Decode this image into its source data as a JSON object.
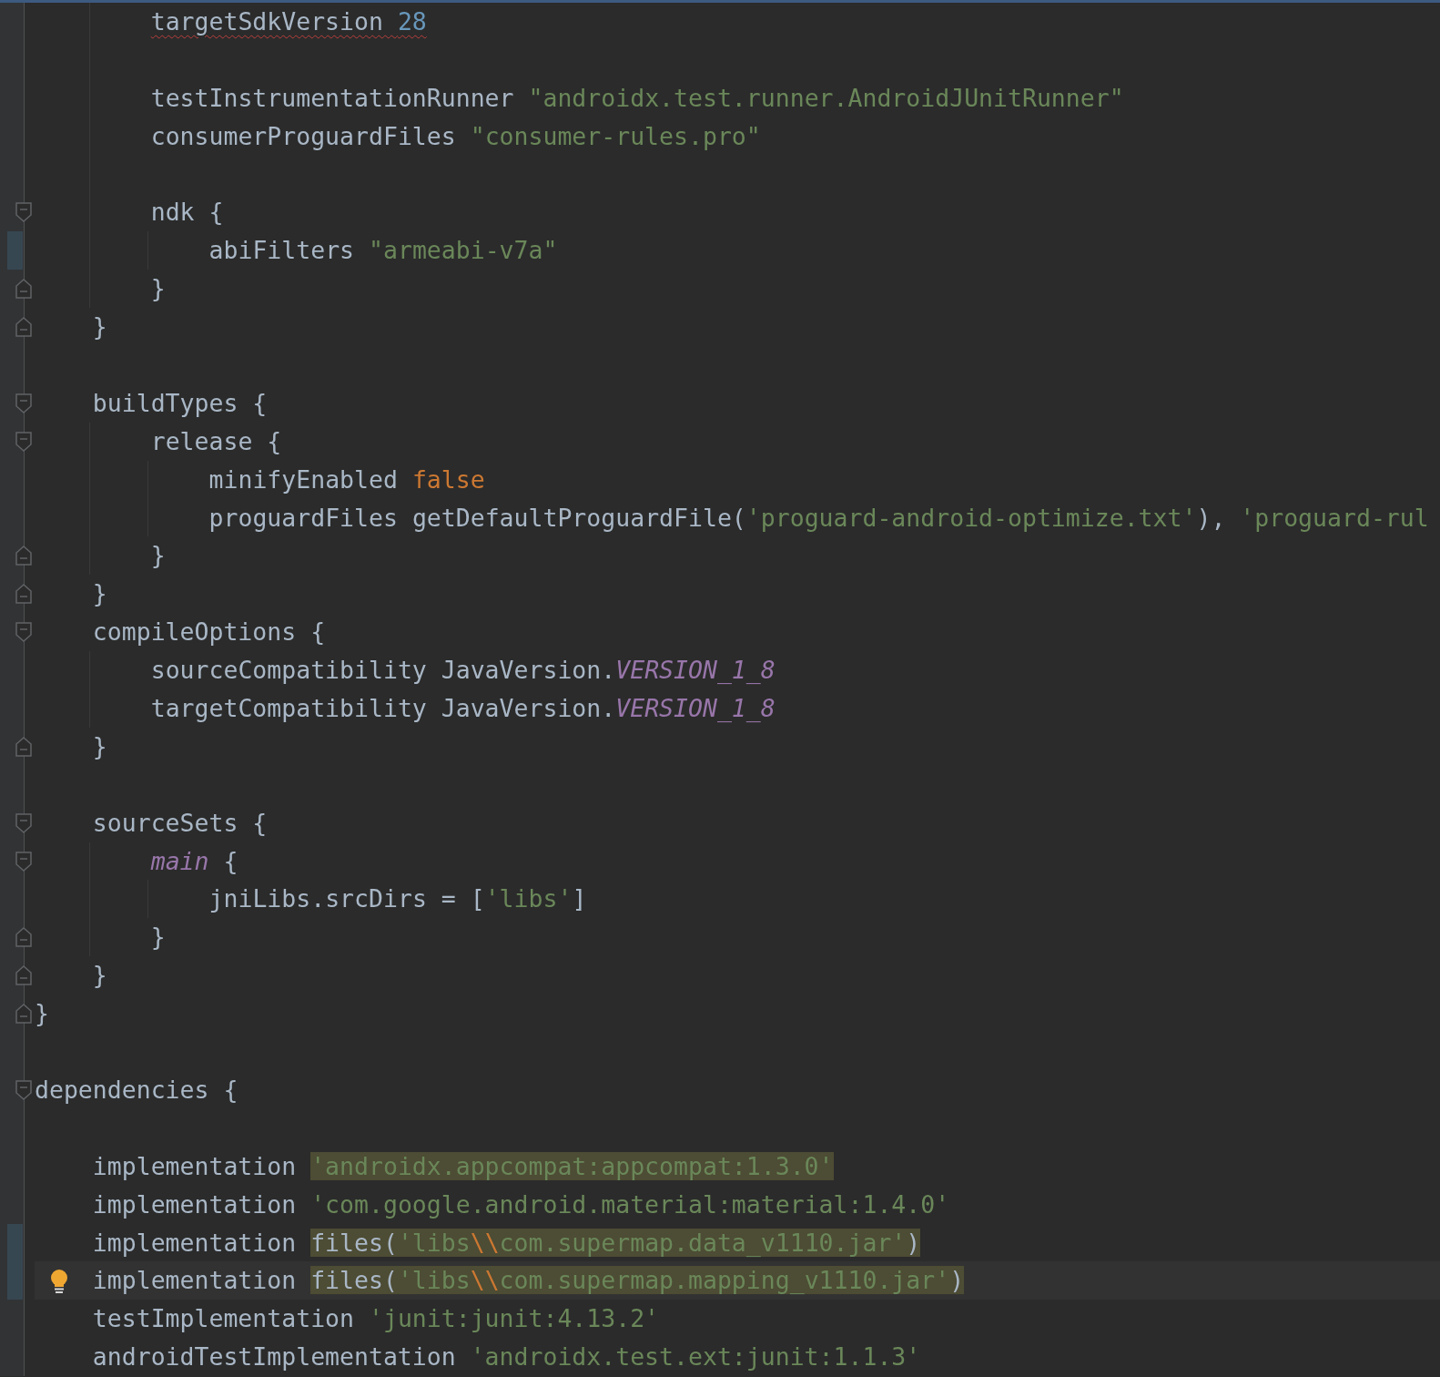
{
  "editor": {
    "lines": [
      {
        "kind": "block",
        "expanded": true,
        "close": "}",
        "children": [
          {
            "kind": "block",
            "expanded": true,
            "close": "}",
            "children": [
              {
                "kind": "line",
                "tokens": [
                  {
                    "text": "targetSdkVersion ",
                    "kind": "plain",
                    "error": true
                  },
                  {
                    "text": "28",
                    "kind": "number",
                    "error": true
                  }
                ]
              },
              {
                "kind": "blank"
              },
              {
                "kind": "line",
                "tokens": [
                  {
                    "text": "testInstrumentationRunner ",
                    "kind": "plain"
                  },
                  {
                    "text": "\"androidx.test.runner.AndroidJUnitRunner\"",
                    "kind": "string"
                  }
                ]
              },
              {
                "kind": "line",
                "tokens": [
                  {
                    "text": "consumerProguardFiles ",
                    "kind": "plain"
                  },
                  {
                    "text": "\"consumer-rules.pro\"",
                    "kind": "string"
                  }
                ]
              },
              {
                "kind": "blank"
              },
              {
                "kind": "block",
                "expanded": true,
                "tokens": [
                  {
                    "text": "ndk {",
                    "kind": "plain"
                  }
                ],
                "close": "}",
                "children": [
                  {
                    "kind": "line",
                    "changed": true,
                    "tokens": [
                      {
                        "text": "abiFilters ",
                        "kind": "plain"
                      },
                      {
                        "text": "\"armeabi-v7a\"",
                        "kind": "string"
                      }
                    ]
                  }
                ]
              }
            ]
          },
          {
            "kind": "blank"
          },
          {
            "kind": "block",
            "expanded": true,
            "tokens": [
              {
                "text": "buildTypes {",
                "kind": "plain"
              }
            ],
            "close": "}",
            "children": [
              {
                "kind": "block",
                "expanded": true,
                "tokens": [
                  {
                    "text": "release {",
                    "kind": "plain"
                  }
                ],
                "close": "}",
                "children": [
                  {
                    "kind": "line",
                    "tokens": [
                      {
                        "text": "minifyEnabled ",
                        "kind": "plain"
                      },
                      {
                        "text": "false",
                        "kind": "keyword"
                      }
                    ]
                  },
                  {
                    "kind": "line",
                    "tokens": [
                      {
                        "text": "proguardFiles getDefaultProguardFile(",
                        "kind": "plain"
                      },
                      {
                        "text": "'proguard-android-optimize.txt'",
                        "kind": "string"
                      },
                      {
                        "text": "), ",
                        "kind": "plain"
                      },
                      {
                        "text": "'proguard-rul",
                        "kind": "string"
                      }
                    ]
                  }
                ]
              }
            ]
          },
          {
            "kind": "block",
            "expanded": true,
            "tokens": [
              {
                "text": "compileOptions {",
                "kind": "plain"
              }
            ],
            "close": "}",
            "children": [
              {
                "kind": "line",
                "tokens": [
                  {
                    "text": "sourceCompatibility JavaVersion.",
                    "kind": "plain"
                  },
                  {
                    "text": "VERSION_1_8",
                    "kind": "constant"
                  }
                ]
              },
              {
                "kind": "line",
                "tokens": [
                  {
                    "text": "targetCompatibility JavaVersion.",
                    "kind": "plain"
                  },
                  {
                    "text": "VERSION_1_8",
                    "kind": "constant"
                  }
                ]
              }
            ]
          },
          {
            "kind": "blank"
          },
          {
            "kind": "block",
            "expanded": true,
            "tokens": [
              {
                "text": "sourceSets {",
                "kind": "plain"
              }
            ],
            "close": "}",
            "children": [
              {
                "kind": "block",
                "expanded": true,
                "tokens": [
                  {
                    "text": "main",
                    "kind": "constant"
                  },
                  {
                    "text": " {",
                    "kind": "plain"
                  }
                ],
                "close": "}",
                "children": [
                  {
                    "kind": "line",
                    "tokens": [
                      {
                        "text": "jniLibs.srcDirs = [",
                        "kind": "plain"
                      },
                      {
                        "text": "'libs'",
                        "kind": "string"
                      },
                      {
                        "text": "]",
                        "kind": "plain"
                      }
                    ]
                  }
                ]
              }
            ]
          }
        ]
      },
      {
        "kind": "blank"
      },
      {
        "kind": "block",
        "expanded": true,
        "tokens": [
          {
            "text": "dependencies {",
            "kind": "plain"
          }
        ],
        "children": [
          {
            "kind": "blank"
          },
          {
            "kind": "line",
            "tokens": [
              {
                "text": "implementation ",
                "kind": "plain"
              },
              {
                "text": "'androidx.appcompat:appcompat:1.3.0'",
                "kind": "string",
                "highlight": true
              }
            ]
          },
          {
            "kind": "line",
            "tokens": [
              {
                "text": "implementation ",
                "kind": "plain"
              },
              {
                "text": "'com.google.android.material:material:1.4.0'",
                "kind": "string"
              }
            ]
          },
          {
            "kind": "line",
            "changed": true,
            "tokens": [
              {
                "text": "implementation ",
                "kind": "plain"
              },
              {
                "text": "files(",
                "kind": "plain",
                "highlight": true
              },
              {
                "text": "'libs",
                "kind": "string",
                "highlight": true
              },
              {
                "text": "\\\\",
                "kind": "escape",
                "highlight": true
              },
              {
                "text": "com.supermap.data_v1110.jar'",
                "kind": "string",
                "highlight": true
              },
              {
                "text": ")",
                "kind": "plain",
                "highlight": true
              }
            ]
          },
          {
            "kind": "line",
            "changed": true,
            "current": true,
            "bulb": true,
            "tokens": [
              {
                "text": "implementation ",
                "kind": "plain"
              },
              {
                "text": "files(",
                "kind": "plain",
                "highlight": true
              },
              {
                "text": "'libs",
                "kind": "string",
                "highlight": true
              },
              {
                "text": "\\\\",
                "kind": "escape",
                "highlight": true
              },
              {
                "text": "com.supermap.mapping_v1110.jar'",
                "kind": "string",
                "highlight": true
              },
              {
                "text": ")",
                "kind": "plain",
                "highlight": true
              }
            ]
          },
          {
            "kind": "line",
            "tokens": [
              {
                "text": "testImplementation ",
                "kind": "plain"
              },
              {
                "text": "'junit:junit:4.13.2'",
                "kind": "string"
              }
            ]
          },
          {
            "kind": "line",
            "tokens": [
              {
                "text": "androidTestImplementation ",
                "kind": "plain"
              },
              {
                "text": "'androidx.test.ext:junit:1.1.3'",
                "kind": "string"
              }
            ]
          }
        ]
      }
    ]
  }
}
